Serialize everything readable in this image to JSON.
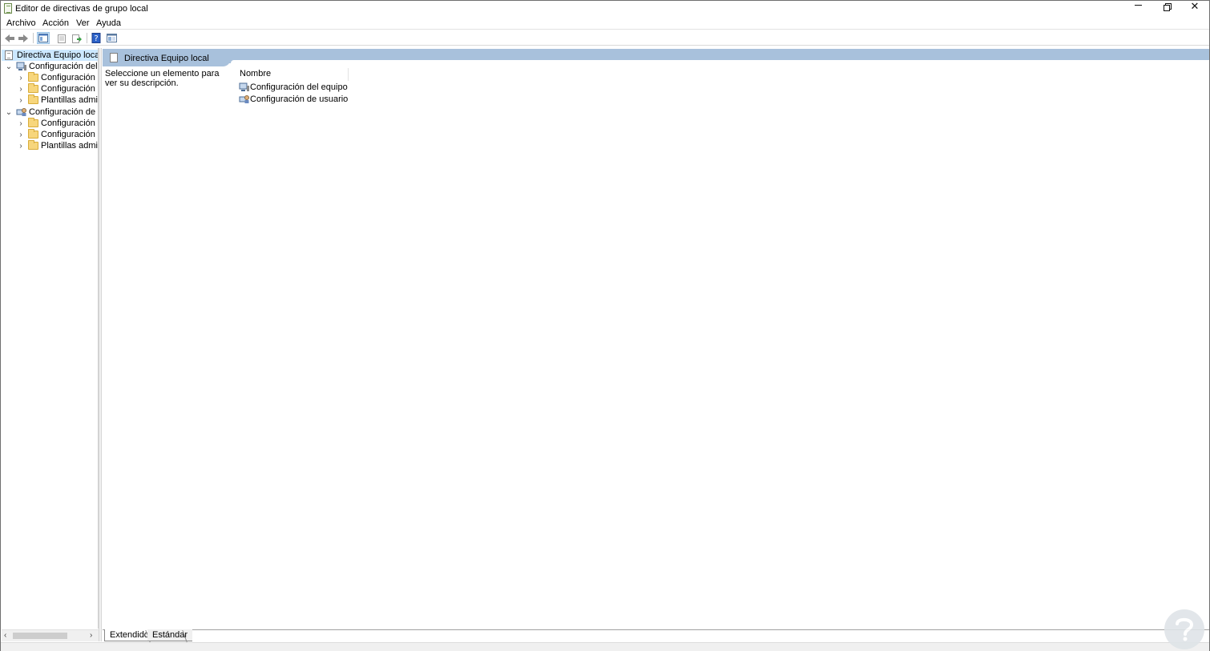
{
  "window": {
    "title": "Editor de directivas de grupo local",
    "close_glyph": "✕"
  },
  "menu": {
    "items": [
      "Archivo",
      "Acción",
      "Ver",
      "Ayuda"
    ]
  },
  "toolbar": {
    "icons": [
      "back-arrow-icon",
      "forward-arrow-icon",
      "show-tree-icon",
      "properties-icon",
      "export-list-icon",
      "help-icon",
      "view-icon"
    ]
  },
  "tree": {
    "root": "Directiva Equipo local",
    "items": [
      {
        "label": "Configuración del equipo",
        "level": 1,
        "expanded": true
      },
      {
        "label": "Configuración de software",
        "level": 2
      },
      {
        "label": "Configuración de Windows",
        "level": 2
      },
      {
        "label": "Plantillas administrativas",
        "level": 2
      },
      {
        "label": "Configuración de usuario",
        "level": 1,
        "expanded": true
      },
      {
        "label": "Configuración de software",
        "level": 2
      },
      {
        "label": "Configuración de Windows",
        "level": 2
      },
      {
        "label": "Plantillas administrativas",
        "level": 2
      }
    ]
  },
  "details": {
    "header_title": "Directiva Equipo local",
    "description": "Seleccione un elemento para ver su descripción.",
    "column_header": "Nombre",
    "rows": [
      "Configuración del equipo",
      "Configuración de usuario"
    ]
  },
  "view_tabs": {
    "extended": "Extendido",
    "standard": "Estándar"
  },
  "colors": {
    "header_band": "#a8c1dc",
    "selection": "#cce8ff",
    "folder": "#f7d67c"
  }
}
